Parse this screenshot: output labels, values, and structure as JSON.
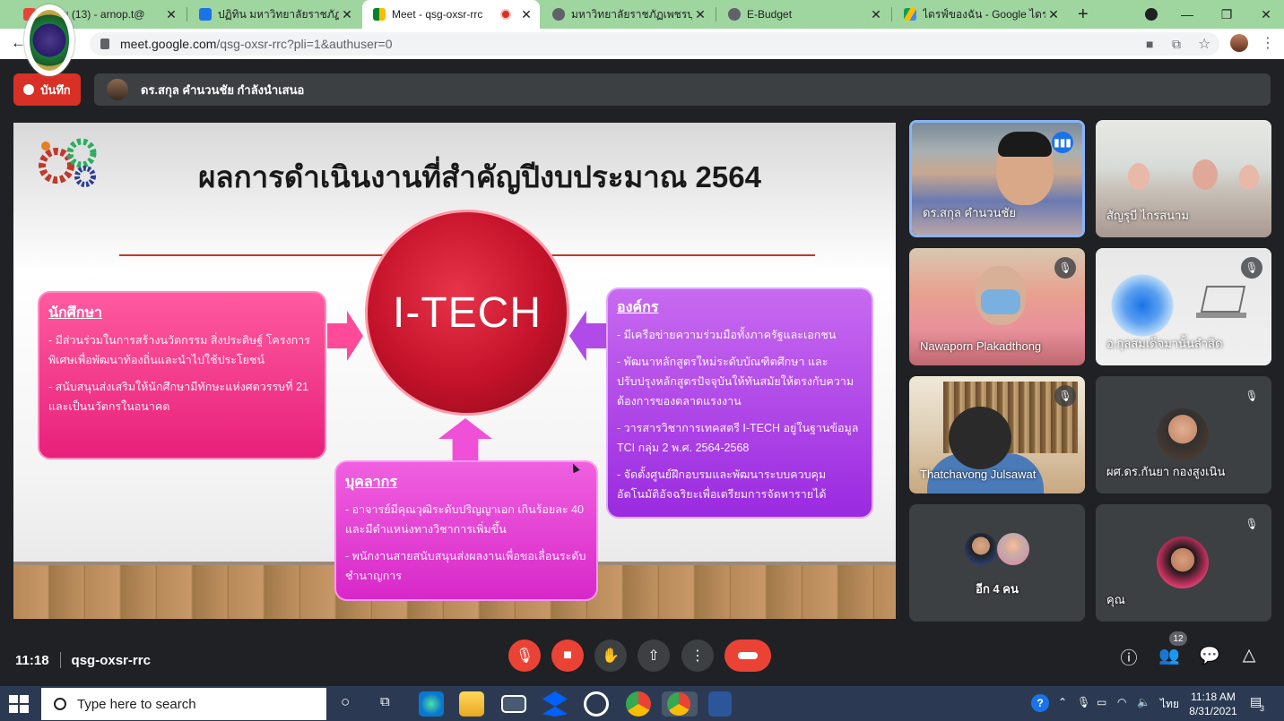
{
  "browser": {
    "tabs": [
      {
        "label": "หมาย (13) - arnop.t@",
        "active": false
      },
      {
        "label": "ปฏิทิน มหาวิทยาลัยราชภัฏเพชร",
        "active": false
      },
      {
        "label": "Meet - qsg-oxsr-rrc",
        "active": true
      },
      {
        "label": "มหาวิทยาลัยราชภัฏเพชรบุรี",
        "active": false
      },
      {
        "label": "E-Budget",
        "active": false
      },
      {
        "label": "ไดรฟ์ของฉัน - Google ไดรฟ์",
        "active": false
      }
    ],
    "new_tab_symbol": "+",
    "url_host": "meet.google.com",
    "url_path": "/qsg-oxsr-rrc?pli=1&authuser=0"
  },
  "meet": {
    "record_label": "บันทึก",
    "presenter_banner": "ดร.สกุล คำนวนชัย กำลังนำเสนอ",
    "meeting_time": "11:18",
    "meeting_code": "qsg-oxsr-rrc",
    "participants_count": "12"
  },
  "slide": {
    "title": "ผลการดำเนินงานที่สำคัญปีงบประมาณ 2564",
    "center": "I-TECH",
    "box_left": {
      "heading": "นักศึกษา",
      "items": [
        "- มีส่วนร่วมในการสร้างนวัตกรรม สิ่งประดิษฐ์ โครงการพิเศษเพื่อพัฒนาท้องถิ่นและนำไปใช้ประโยชน์",
        "- สนับสนุนส่งเสริมให้นักศึกษามีทักษะแห่งศตวรรษที่ 21 และเป็นนวัตกรในอนาคต"
      ]
    },
    "box_right": {
      "heading": "องค์กร",
      "items": [
        "- มีเครือข่ายความร่วมมือทั้งภาครัฐและเอกชน",
        "- พัฒนาหลักสูตรใหม่ระดับบัณฑิตศึกษา และปรับปรุงหลักสูตรปัจจุบันให้ทันสมัยให้ตรงกับความต้องการของตลาดแรงงาน",
        "- วารสารวิชาการเทคสตรี I-TECH อยู่ในฐานข้อมูล TCI กลุ่ม 2 พ.ศ. 2564-2568",
        "- จัดตั้งศูนย์ฝึกอบรมและพัฒนาระบบควบคุมอัตโนมัติอัจฉริยะเพื่อเตรียมการจัดหารายได้"
      ]
    },
    "box_bottom": {
      "heading": "บุคลากร",
      "items": [
        "- อาจารย์มีคุณวุฒิระดับปริญญาเอก เกินร้อยละ 40 และมีตำแหน่งทางวิชาการเพิ่มขึ้น",
        "- พนักงานสายสนับสนุนส่งผลงานเพื่อขอเลื่อนระดับชำนาญการ"
      ]
    }
  },
  "participants": [
    {
      "name": "ดร.สกุล คำนวนชัย",
      "speaking": true
    },
    {
      "name": "สัญรุบี ไกรสนาม",
      "speaking": false
    },
    {
      "name": "Nawaporn Plakadthong",
      "muted": true
    },
    {
      "name": "อ.กุลสมเด็จมานั้นลำสิด",
      "muted": true
    },
    {
      "name": "Thatchavong Julsawat",
      "muted": true
    },
    {
      "name": "ผศ.ดร.กันยา กองสูงเนิน",
      "muted": true
    },
    {
      "name": "อีก 4 คน"
    },
    {
      "name": "คุณ",
      "muted": true
    }
  ],
  "taskbar": {
    "search_placeholder": "Type here to search",
    "language": "ไทย",
    "time": "11:18 AM",
    "date": "8/31/2021",
    "notifications": "3"
  },
  "colors": {
    "accent": "#1a73e8",
    "record": "#d93025",
    "hangup": "#ea4335",
    "tabstrip": "#9fd59f"
  }
}
